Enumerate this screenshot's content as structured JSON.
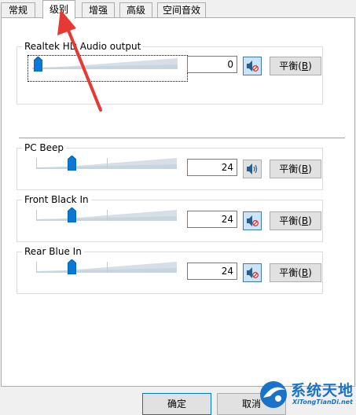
{
  "tabs": [
    {
      "label": "常规",
      "active": false
    },
    {
      "label": "级别",
      "active": true
    },
    {
      "label": "增强",
      "active": false
    },
    {
      "label": "高级",
      "active": false
    },
    {
      "label": "空间音效",
      "active": false
    }
  ],
  "master": {
    "title": "Realtek HD Audio output",
    "value": "0",
    "level": 0,
    "muted": true,
    "balance_label": "平衡",
    "balance_key": "B"
  },
  "devices": [
    {
      "title": "PC Beep",
      "value": "24",
      "level": 0.24,
      "muted": false,
      "balance_label": "平衡",
      "balance_key": "B"
    },
    {
      "title": "Front Black In",
      "value": "24",
      "level": 0.24,
      "muted": true,
      "balance_label": "平衡",
      "balance_key": "B"
    },
    {
      "title": "Rear Blue In",
      "value": "24",
      "level": 0.24,
      "muted": true,
      "balance_label": "平衡",
      "balance_key": "B"
    }
  ],
  "footer": {
    "ok_label": "确定",
    "cancel_label": "取消"
  },
  "watermark": {
    "title": "系统天地",
    "site": "XiTongTianDi.net"
  },
  "colors": {
    "accent": "#0078d7",
    "annotation_arrow": "#e53935",
    "mute_active": "#cce4f7"
  }
}
